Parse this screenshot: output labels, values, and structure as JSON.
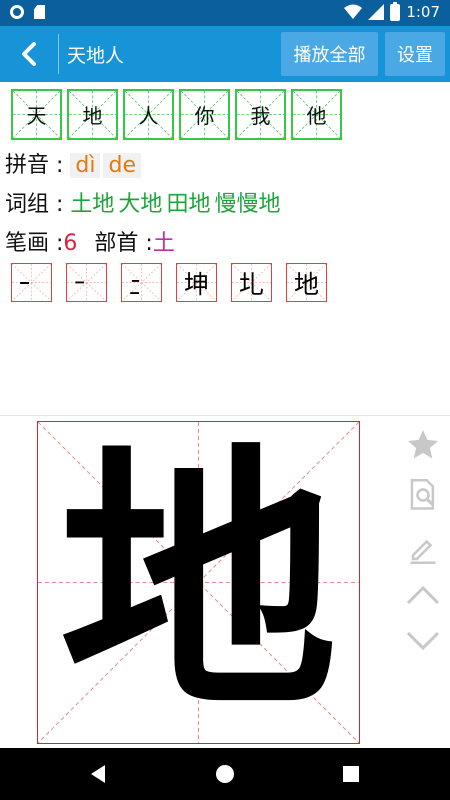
{
  "status_bar": {
    "time": "1:07",
    "icons": [
      "record-icon",
      "sd-card-icon",
      "wifi-icon",
      "signal-icon",
      "battery-icon"
    ]
  },
  "app_bar": {
    "title": "天地人",
    "play_all_label": "播放全部",
    "settings_label": "设置",
    "back_icon": "back-arrow-icon"
  },
  "character_list": [
    "天",
    "地",
    "人",
    "你",
    "我",
    "他"
  ],
  "details": {
    "pinyin_label": "拼音 :",
    "pinyin": [
      "dì",
      "de"
    ],
    "words_label": "词组 :",
    "words": [
      "土地",
      "大地",
      "田地",
      "慢慢地"
    ],
    "strokes_label": "笔画 :",
    "stroke_count": "6",
    "radical_label": "部首 :",
    "radical": "土"
  },
  "stroke_steps": [
    "一",
    "十",
    "土",
    "坤",
    "圠",
    "地"
  ],
  "main_character": "地",
  "side_tools": [
    "star-icon",
    "lookup-icon",
    "pencil-icon",
    "chevron-up-icon",
    "chevron-down-icon"
  ],
  "colors": {
    "app_bar": "#1793d8",
    "status_bar": "#0b5f9c",
    "grid_green": "#38c848",
    "grid_red": "#e3202a",
    "pinyin": "#e07a12",
    "words": "#1ea53a",
    "count": "#d8233d",
    "radical": "#c42ca0"
  }
}
